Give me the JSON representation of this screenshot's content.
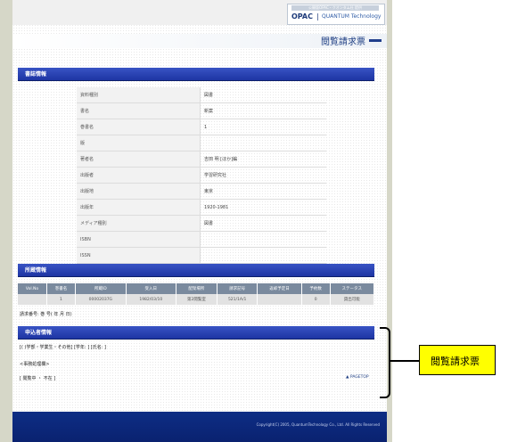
{
  "header": {
    "logo_top": "公開版OPAC・クオンタム社 提供",
    "logo_opac": "OPAC",
    "logo_sep": "|",
    "logo_quantum": "QUANTUM Technology",
    "page_title": "閲覧請求票"
  },
  "sections": {
    "bibliographic": "書誌情報",
    "holdings": "所蔵情報",
    "applicant": "申込者情報"
  },
  "bib_rows": [
    {
      "label": "資料種別",
      "value": "図書"
    },
    {
      "label": "書名",
      "value": "新案"
    },
    {
      "label": "巻書名",
      "value": "1"
    },
    {
      "label": "版",
      "value": ""
    },
    {
      "label": "著者名",
      "value": "吉田 明 [ほか]編"
    },
    {
      "label": "出版者",
      "value": "学習研究社"
    },
    {
      "label": "出版地",
      "value": "東京"
    },
    {
      "label": "出版年",
      "value": "1920-1981"
    },
    {
      "label": "メディア種別",
      "value": "図書"
    },
    {
      "label": "ISBN",
      "value": ""
    },
    {
      "label": "ISSN",
      "value": ""
    }
  ],
  "holdings": {
    "headers": [
      "Vol.No",
      "巻書名",
      "所蔵ID",
      "受入日",
      "配架場所",
      "請求記号",
      "返却予定日",
      "予約数",
      "ステータス"
    ],
    "rows": [
      [
        "",
        "1",
        "00002037G",
        "1982/03/10",
        "第2閲覧室",
        "521/1A/1",
        "",
        "0",
        "貸出可能"
      ]
    ]
  },
  "request_no": "請求番号:         巻         号(         年         月         日)",
  "applicant_line": "[(               )学部・学業生・その他]   [学年:          ]   [氏名:                                    ]",
  "office_label": "<事務処理欄>",
  "office_status": "[ 閲覧中    ・    不在 ]",
  "pagetop": "▲ PAGETOP",
  "footer": "Copyright(C) 2005, QuantumTechnology Co., Ltd. All Rights Reserved",
  "callout": "閲覧請求票"
}
